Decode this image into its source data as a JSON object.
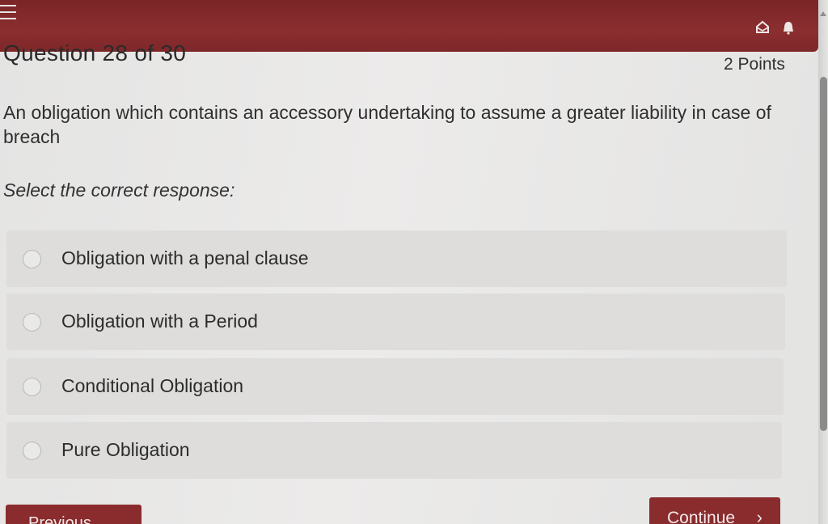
{
  "header": {
    "menu_icon": "hamburger-menu-icon",
    "icons": [
      "mail-icon",
      "bell-icon"
    ],
    "accent_color": "#862b2d"
  },
  "question": {
    "title": "Question 28 of 30",
    "points": "2 Points",
    "text": "An obligation which contains an accessory undertaking to assume a greater liability in case of breach",
    "instruction": "Select the correct response:"
  },
  "options": [
    {
      "label": "Obligation with a penal clause"
    },
    {
      "label": "Obligation with a Period"
    },
    {
      "label": "Conditional Obligation"
    },
    {
      "label": "Pure Obligation"
    }
  ],
  "footer": {
    "previous_label": "Previous",
    "continue_label": "Continue",
    "continue_chevron": "›"
  }
}
